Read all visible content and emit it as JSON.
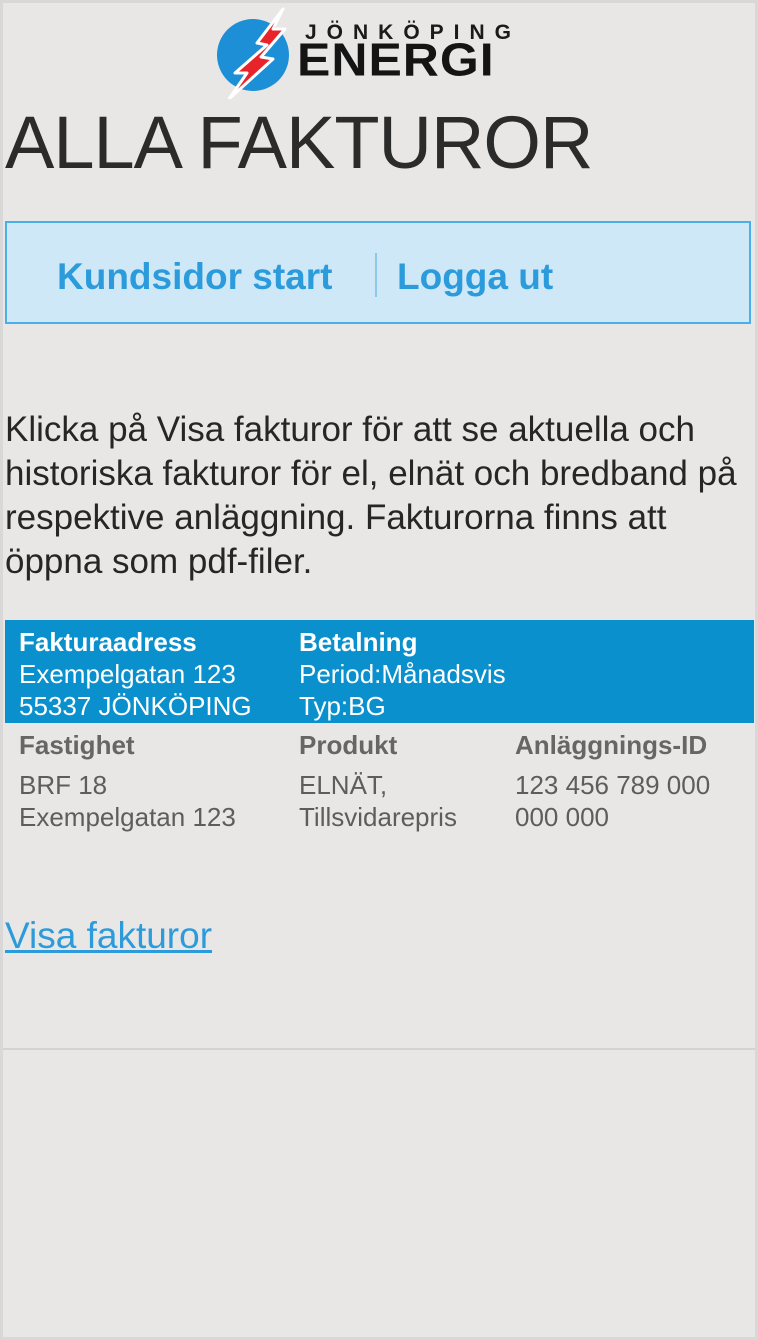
{
  "brand": {
    "top_line": "JÖNKÖPING",
    "main_line": "ENERGI",
    "colors": {
      "circle": "#1c8fd6",
      "bolt": "#e8232a"
    }
  },
  "page_title": "ALLA FAKTUROR",
  "nav": {
    "start_label": "Kundsidor start",
    "logout_label": "Logga ut"
  },
  "intro_text": "Klicka på Visa fakturor för att se aktuella och historiska fakturor för el, elnät och bredband på respektive anläggning. Fakturorna finns att öppna som pdf-filer.",
  "billing": {
    "address_header": "Fakturaadress",
    "address_line1": "Exempelgatan 123",
    "address_line2": "55337 JÖNKÖPING",
    "payment_header": "Betalning",
    "period": "Period:Månadsvis",
    "type": "Typ:BG"
  },
  "facility": {
    "property_header": "Fastighet",
    "property_line1": "BRF 18",
    "property_line2": "Exempelgatan 123",
    "product_header": "Produkt",
    "product_line1": "ELNÄT,",
    "product_line2": "Tillsvidarepris",
    "id_header": "Anläggnings-ID",
    "id_line1": "123 456 789 000",
    "id_line2": "000 000"
  },
  "show_invoices_label": "Visa fakturor",
  "colors": {
    "accent": "#2c9bdc",
    "billing_bar": "#0a90cc",
    "nav_background": "#cfe8f7",
    "page_background": "#e8e7e6"
  }
}
